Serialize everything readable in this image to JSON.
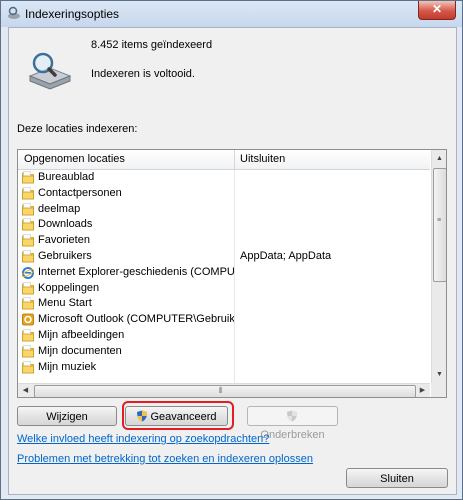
{
  "window": {
    "title": "Indexeringsopties",
    "close_glyph": "✕"
  },
  "summary": {
    "item_count": "8.452 items geïndexeerd",
    "status": "Indexeren is voltooid."
  },
  "locations_label": "Deze locaties indexeren:",
  "table": {
    "columns": [
      "Opgenomen locaties",
      "Uitsluiten"
    ],
    "rows": [
      {
        "icon": "folder-icon",
        "name": "Bureaublad",
        "exclude": ""
      },
      {
        "icon": "folder-icon",
        "name": "Contactpersonen",
        "exclude": ""
      },
      {
        "icon": "folder-icon",
        "name": "deelmap",
        "exclude": ""
      },
      {
        "icon": "folder-icon",
        "name": "Downloads",
        "exclude": ""
      },
      {
        "icon": "folder-icon",
        "name": "Favorieten",
        "exclude": ""
      },
      {
        "icon": "folder-icon",
        "name": "Gebruikers",
        "exclude": "AppData; AppData"
      },
      {
        "icon": "internet-explorer-icon",
        "name": "Internet Explorer-geschiedenis (COMPUTER",
        "exclude": ""
      },
      {
        "icon": "folder-icon",
        "name": "Koppelingen",
        "exclude": ""
      },
      {
        "icon": "folder-icon",
        "name": "Menu Start",
        "exclude": ""
      },
      {
        "icon": "outlook-icon",
        "name": "Microsoft Outlook (COMPUTER\\Gebruiker)",
        "exclude": ""
      },
      {
        "icon": "folder-icon",
        "name": "Mijn afbeeldingen",
        "exclude": ""
      },
      {
        "icon": "folder-icon",
        "name": "Mijn documenten",
        "exclude": ""
      },
      {
        "icon": "folder-icon",
        "name": "Mijn muziek",
        "exclude": ""
      }
    ]
  },
  "buttons": {
    "modify": "Wijzigen",
    "advanced": "Geavanceerd",
    "pause": "Onderbreken",
    "close": "Sluiten"
  },
  "links": {
    "influence": "Welke invloed heeft indexering op zoekopdrachten?",
    "troubleshoot": "Problemen met betrekking tot zoeken en indexeren oplossen"
  },
  "colors": {
    "highlight": "#e01e24",
    "link": "#0066cc",
    "folder": "#f5c342"
  }
}
